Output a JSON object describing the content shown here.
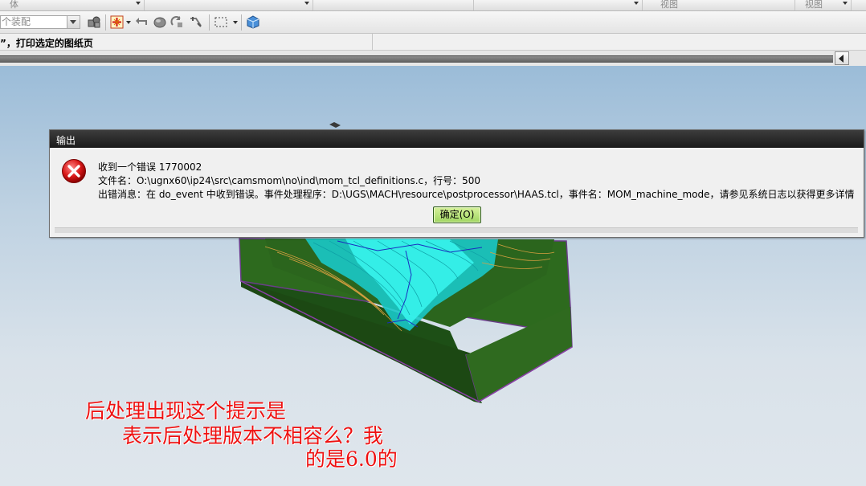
{
  "menubar": {
    "segments": [
      "体",
      "",
      "",
      "",
      "",
      "视图",
      "视图"
    ]
  },
  "toolbar": {
    "assembly_combo": "个装配",
    "icons": [
      "assembly-navigator-icon",
      "snap-point-icon",
      "undo-arrow-icon",
      "shade-icon",
      "rotate-icon",
      "pan-icon",
      "box-select-icon",
      "view-cube-icon"
    ]
  },
  "cue_line": {
    "text": "”，打印选定的图纸页"
  },
  "dialog": {
    "title": "输出",
    "line1": "收到一个错误 1770002",
    "line2": "文件名：O:\\ugnx60\\ip24\\src\\camsmom\\no\\ind\\mom_tcl_definitions.c，行号：500",
    "line3": "出错消息：在 do_event 中收到错误。事件处理程序：D:\\UGS\\MACH\\resource\\postprocessor\\HAAS.tcl，事件名：MOM_machine_mode，请参见系统日志以获得更多详情",
    "ok_label": "确定(O)",
    "icon": "error-icon"
  },
  "annotation": {
    "line1": "后处理出现这个提示是",
    "line2": "表示后处理版本不相容么？我",
    "line3": "的是6.0的",
    "color": "#ee1111"
  },
  "colors": {
    "part_green": "#2f6a1f",
    "toolpath_cyan": "#22e0e0",
    "dialog_title_bg": "#1f1f1f",
    "ok_button": "#b7e37b"
  }
}
